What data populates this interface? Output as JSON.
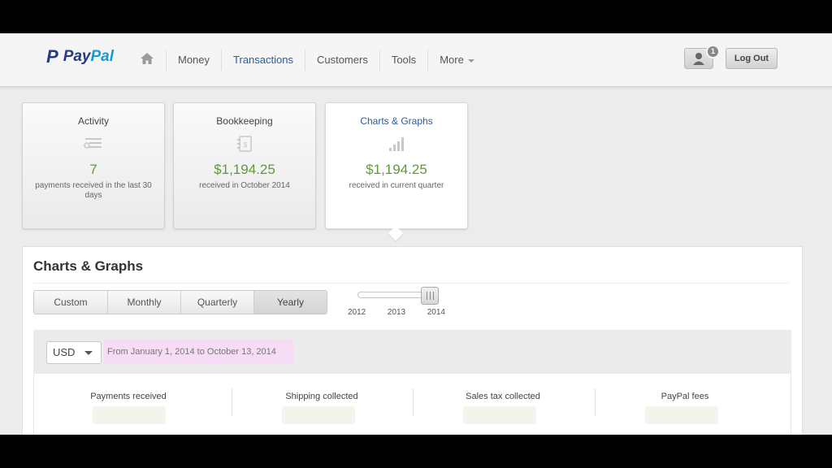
{
  "header": {
    "logo_mark": "P",
    "logo_pay": "Pay",
    "logo_pal": "Pal",
    "nav": [
      "Money",
      "Transactions",
      "Customers",
      "Tools",
      "More"
    ],
    "active_nav": "Transactions",
    "notification_count": "1",
    "logout_label": "Log Out"
  },
  "cards": [
    {
      "title": "Activity",
      "value": "7",
      "caption": "payments received in the last 30 days",
      "icon": "list-icon"
    },
    {
      "title": "Bookkeeping",
      "value": "$1,194.25",
      "caption": "received in October 2014",
      "icon": "ledger-icon"
    },
    {
      "title": "Charts & Graphs",
      "value": "$1,194.25",
      "caption": "received in current quarter",
      "icon": "bar-chart-icon"
    }
  ],
  "panel": {
    "title": "Charts & Graphs",
    "periods": [
      "Custom",
      "Monthly",
      "Quarterly",
      "Yearly"
    ],
    "selected_period": "Yearly",
    "years": [
      "2012",
      "2013",
      "2014"
    ],
    "selected_year": "2014",
    "currency": "USD",
    "date_range": "From January 1, 2014 to October 13, 2014",
    "metrics": [
      "Payments received",
      "Shipping collected",
      "Sales tax collected",
      "PayPal fees"
    ]
  },
  "colors": {
    "accent_blue": "#2c5aa0",
    "value_green": "#5f9a3a",
    "date_highlight": "#f6dcf5"
  }
}
